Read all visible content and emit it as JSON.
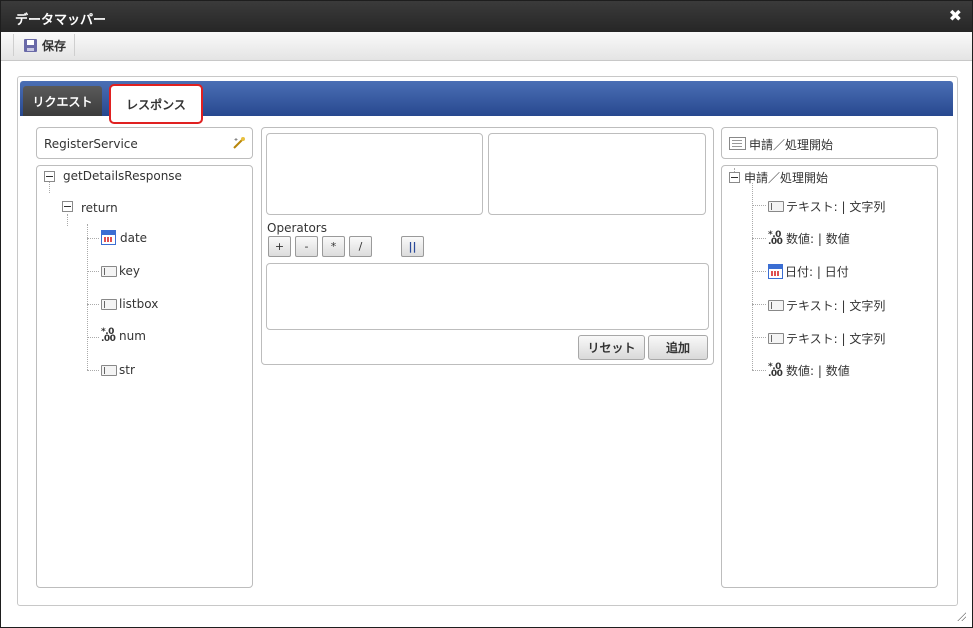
{
  "window": {
    "title": "データマッパー",
    "close_glyph": "✖"
  },
  "toolbar": {
    "save_label": "保存"
  },
  "tabs": [
    {
      "label": "リクエスト",
      "active": false
    },
    {
      "label": "レスポンス",
      "active": true
    }
  ],
  "left_panel": {
    "service_name": "RegisterService",
    "tree": {
      "root": "getDetailsResponse",
      "child": "return",
      "fields": [
        {
          "label": "date",
          "icon": "date-icon"
        },
        {
          "label": "key",
          "icon": "string-icon"
        },
        {
          "label": "listbox",
          "icon": "string-icon"
        },
        {
          "label": "num",
          "icon": "number-icon"
        },
        {
          "label": "str",
          "icon": "string-icon"
        }
      ]
    }
  },
  "middle_panel": {
    "operators_label": "Operators",
    "operators": [
      "+",
      "-",
      "*",
      "/",
      "||"
    ],
    "reset_label": "リセット",
    "add_label": "追加"
  },
  "right_panel": {
    "header": "申請／処理開始",
    "tree": {
      "root": "申請／処理開始",
      "fields": [
        {
          "label": "テキスト: | 文字列",
          "icon": "string-icon"
        },
        {
          "label": "数値: | 数値",
          "icon": "number-icon"
        },
        {
          "label": "日付: | 日付",
          "icon": "date-icon"
        },
        {
          "label": "テキスト: | 文字列",
          "icon": "string-icon"
        },
        {
          "label": "テキスト: | 文字列",
          "icon": "string-icon"
        },
        {
          "label": "数値: | 数値",
          "icon": "number-icon"
        }
      ]
    }
  },
  "colors": {
    "tabbar": "#27488f",
    "active_tab_border": "#e02020",
    "titlebar": "#2e2e2e"
  }
}
